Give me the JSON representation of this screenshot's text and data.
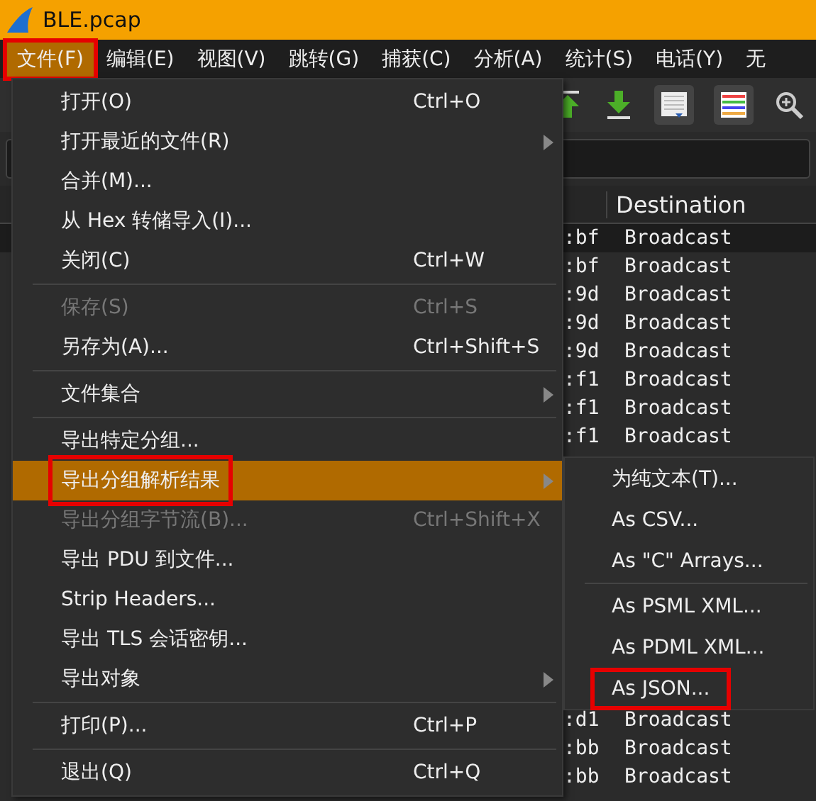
{
  "window": {
    "title": "BLE.pcap"
  },
  "menubar": [
    {
      "label": "文件(F)",
      "selected": true,
      "boxed": true
    },
    {
      "label": "编辑(E)",
      "selected": false,
      "boxed": false
    },
    {
      "label": "视图(V)",
      "selected": false,
      "boxed": false
    },
    {
      "label": "跳转(G)",
      "selected": false,
      "boxed": false
    },
    {
      "label": "捕获(C)",
      "selected": false,
      "boxed": false
    },
    {
      "label": "分析(A)",
      "selected": false,
      "boxed": false
    },
    {
      "label": "统计(S)",
      "selected": false,
      "boxed": false
    },
    {
      "label": "电话(Y)",
      "selected": false,
      "boxed": false
    },
    {
      "label": "无",
      "selected": false,
      "boxed": false
    }
  ],
  "packet_list": {
    "columns": [
      {
        "label": "Destination"
      }
    ],
    "rows_above": [
      {
        "column_2": ":bf",
        "destination": "Broadcast",
        "selected": true
      },
      {
        "column_2": ":bf",
        "destination": "Broadcast",
        "selected": false
      },
      {
        "column_2": ":9d",
        "destination": "Broadcast",
        "selected": false
      },
      {
        "column_2": ":9d",
        "destination": "Broadcast",
        "selected": false
      },
      {
        "column_2": ":9d",
        "destination": "Broadcast",
        "selected": false
      },
      {
        "column_2": ":f1",
        "destination": "Broadcast",
        "selected": false
      },
      {
        "column_2": ":f1",
        "destination": "Broadcast",
        "selected": false
      },
      {
        "column_2": ":f1",
        "destination": "Broadcast",
        "selected": false
      }
    ],
    "rows_below": [
      {
        "column_2": ":d1",
        "destination": "Broadcast",
        "selected": false
      },
      {
        "column_2": ":bb",
        "destination": "Broadcast",
        "selected": false
      },
      {
        "column_2": ":bb",
        "destination": "Broadcast",
        "selected": false
      }
    ]
  },
  "file_menu": [
    {
      "kind": "item",
      "label": "打开(O)",
      "shortcut": "Ctrl+O",
      "submenu": false,
      "disabled": false,
      "selected": false,
      "boxed": false
    },
    {
      "kind": "item",
      "label": "打开最近的文件(R)",
      "submenu": true,
      "disabled": false,
      "selected": false,
      "boxed": false
    },
    {
      "kind": "item",
      "label": "合并(M)...",
      "submenu": false,
      "disabled": false,
      "selected": false,
      "boxed": false
    },
    {
      "kind": "item",
      "label": "从 Hex 转储导入(I)...",
      "submenu": false,
      "disabled": false,
      "selected": false,
      "boxed": false
    },
    {
      "kind": "item",
      "label": "关闭(C)",
      "shortcut": "Ctrl+W",
      "submenu": false,
      "disabled": false,
      "selected": false,
      "boxed": false
    },
    {
      "kind": "separator"
    },
    {
      "kind": "item",
      "label": "保存(S)",
      "shortcut": "Ctrl+S",
      "submenu": false,
      "disabled": true,
      "selected": false,
      "boxed": false
    },
    {
      "kind": "item",
      "label": "另存为(A)...",
      "shortcut": "Ctrl+Shift+S",
      "submenu": false,
      "disabled": false,
      "selected": false,
      "boxed": false
    },
    {
      "kind": "separator"
    },
    {
      "kind": "item",
      "label": "文件集合",
      "submenu": true,
      "disabled": false,
      "selected": false,
      "boxed": false
    },
    {
      "kind": "separator"
    },
    {
      "kind": "item",
      "label": "导出特定分组...",
      "submenu": false,
      "disabled": false,
      "selected": false,
      "boxed": false
    },
    {
      "kind": "item",
      "label": "导出分组解析结果",
      "submenu": true,
      "disabled": false,
      "selected": true,
      "boxed": true
    },
    {
      "kind": "item",
      "label": "导出分组字节流(B)...",
      "shortcut": "Ctrl+Shift+X",
      "submenu": false,
      "disabled": true,
      "selected": false,
      "boxed": false
    },
    {
      "kind": "item",
      "label": "导出 PDU 到文件...",
      "submenu": false,
      "disabled": false,
      "selected": false,
      "boxed": false
    },
    {
      "kind": "item",
      "label": "Strip Headers...",
      "submenu": false,
      "disabled": false,
      "selected": false,
      "boxed": false
    },
    {
      "kind": "item",
      "label": "导出 TLS 会话密钥...",
      "submenu": false,
      "disabled": false,
      "selected": false,
      "boxed": false
    },
    {
      "kind": "item",
      "label": "导出对象",
      "submenu": true,
      "disabled": false,
      "selected": false,
      "boxed": false
    },
    {
      "kind": "separator"
    },
    {
      "kind": "item",
      "label": "打印(P)...",
      "shortcut": "Ctrl+P",
      "submenu": false,
      "disabled": false,
      "selected": false,
      "boxed": false
    },
    {
      "kind": "separator"
    },
    {
      "kind": "item",
      "label": "退出(Q)",
      "shortcut": "Ctrl+Q",
      "submenu": false,
      "disabled": false,
      "selected": false,
      "boxed": false
    }
  ],
  "export_submenu": [
    {
      "kind": "item",
      "label": "为纯文本(T)...",
      "boxed": false
    },
    {
      "kind": "item",
      "label": "As CSV...",
      "boxed": false
    },
    {
      "kind": "item",
      "label": "As \"C\" Arrays...",
      "boxed": false
    },
    {
      "kind": "separator"
    },
    {
      "kind": "item",
      "label": "As PSML XML...",
      "boxed": false
    },
    {
      "kind": "item",
      "label": "As PDML XML...",
      "boxed": false
    },
    {
      "kind": "item",
      "label": "As JSON...",
      "boxed": true
    }
  ]
}
